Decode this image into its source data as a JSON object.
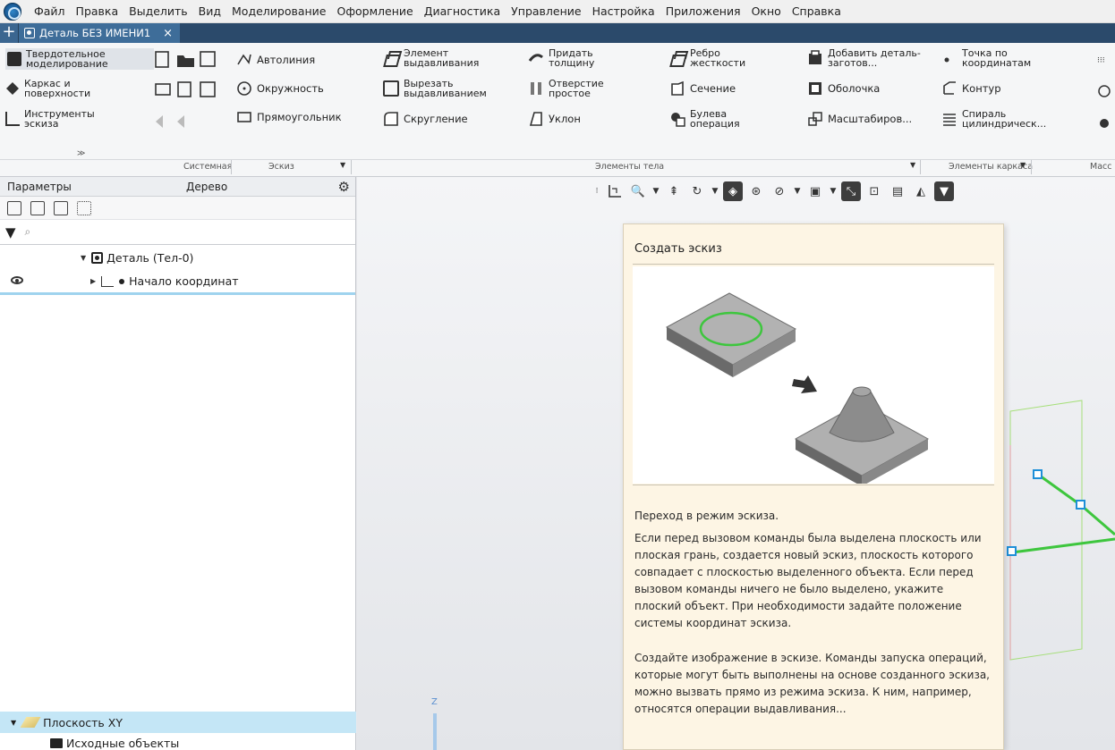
{
  "menu": [
    "Файл",
    "Правка",
    "Выделить",
    "Вид",
    "Моделирование",
    "Оформление",
    "Диагностика",
    "Управление",
    "Настройка",
    "Приложения",
    "Окно",
    "Справка"
  ],
  "tab": {
    "title": "Деталь БЕЗ ИМЕНИ1",
    "close": "×",
    "new": "+"
  },
  "ribbon": {
    "modes": [
      "Твердотельное моделирование",
      "Каркас и поверхности",
      "Инструменты эскиза"
    ],
    "sketch_tools": [
      "Автолиния",
      "Окружность",
      "Прямоугольник"
    ],
    "body_col1": [
      "Элемент выдавливания",
      "Вырезать выдавливанием",
      "Скругление"
    ],
    "body_col2": [
      "Придать толщину",
      "Отверстие простое",
      "Уклон"
    ],
    "body_col3": [
      "Ребро жесткости",
      "Сечение",
      "Булева операция"
    ],
    "body_col4": [
      "Добавить деталь-заготов...",
      "Оболочка",
      "Масштабиров..."
    ],
    "frame_col": [
      "Точка по координатам",
      "Контур",
      "Спираль цилиндрическ..."
    ],
    "groups": [
      "Системная",
      "Эскиз",
      "Элементы тела",
      "Элементы каркаса",
      "Масс"
    ]
  },
  "panel": {
    "tab_params": "Параметры",
    "tab_tree": "Дерево",
    "search_placeholder": "",
    "tree": {
      "detail": "Деталь (Тел-0)",
      "origin": "Начало координат",
      "plane": "Плоскость XY",
      "source": "Исходные объекты"
    }
  },
  "viewport": {
    "axis_label": "Z"
  },
  "tooltip": {
    "title": "Создать эскиз",
    "p1": "Переход в режим эскиза.",
    "p2": "Если перед вызовом команды была выделена плоскость или плоская грань, создается новый эскиз, плоскость которого совпадает с плоскостью выделенного объекта. Если перед вызовом команды ничего не было выделено, укажите плоский объект. При необходимости задайте положение системы координат эскиза.",
    "p3": "Создайте изображение в эскизе. Команды запуска операций, которые могут быть выполнены на основе созданного эскиза, можно вызвать прямо из режима эскиза. К ним, например, относятся операции выдавливания..."
  },
  "colors": {
    "highlight": "#c4e6f6",
    "tooltip_bg": "#fdf5e4",
    "sketch_green": "#3ec63e",
    "handle_blue": "#1e8fd8"
  }
}
